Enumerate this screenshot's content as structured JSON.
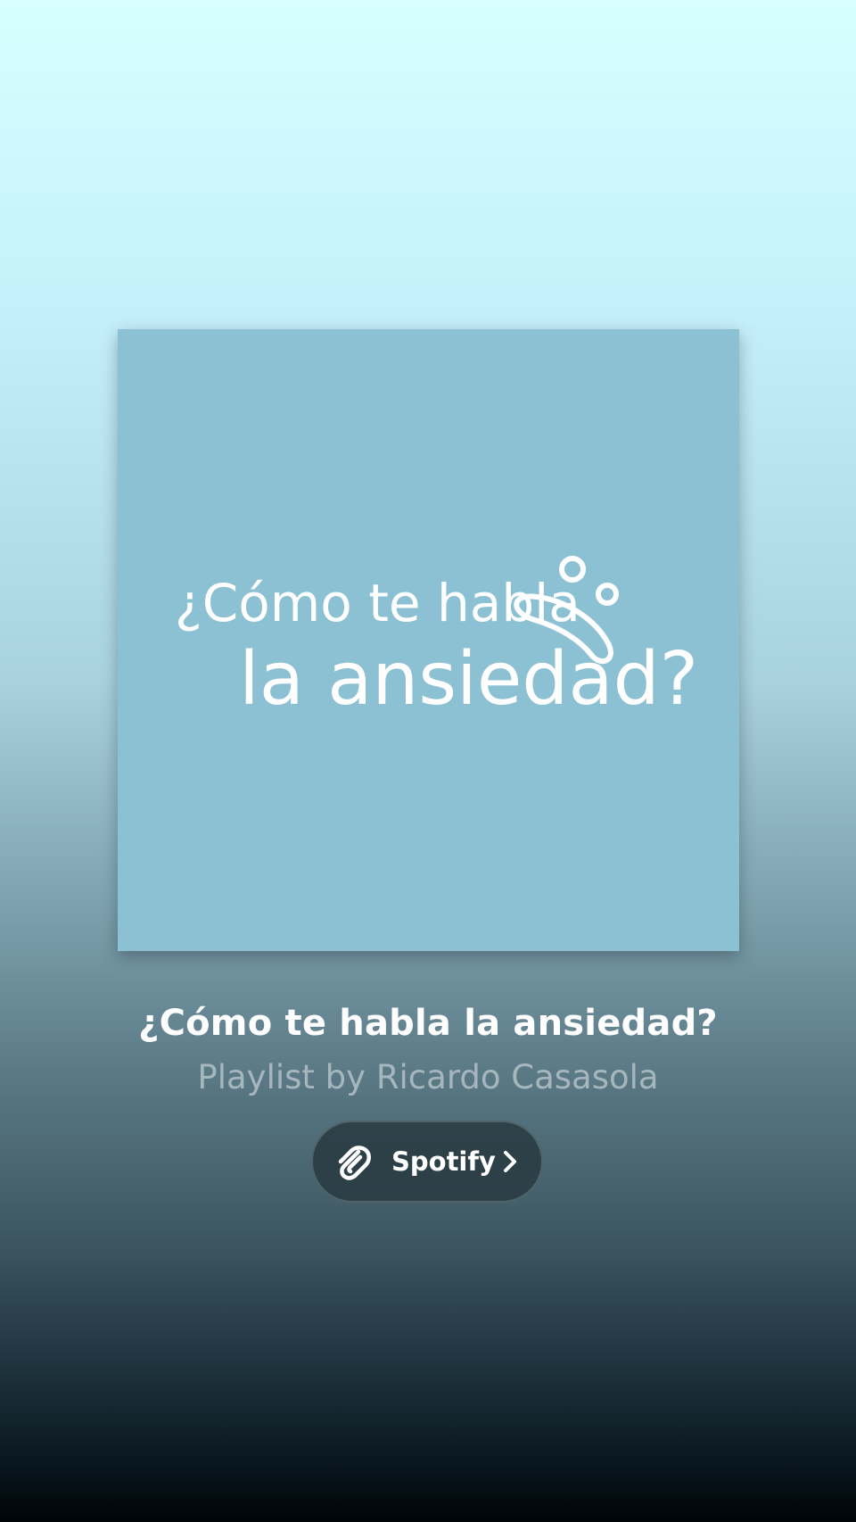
{
  "cover": {
    "line1": "¿Cómo te habla",
    "line2": "la ansiedad?",
    "background_color": "#8bc1d3",
    "logo_icon": "bubble-face-icon"
  },
  "playlist": {
    "title": "¿Cómo te habla la ansiedad?",
    "subtitle": "Playlist by Ricardo Casasola"
  },
  "link": {
    "label": "Spotify",
    "icon": "paperclip-icon",
    "arrow_icon": "chevron-right-icon"
  },
  "colors": {
    "background_top": "#d6fffe",
    "background_bottom": "#000407",
    "subtitle": "#a6b6bd",
    "pill_background": "#2a3c44"
  }
}
